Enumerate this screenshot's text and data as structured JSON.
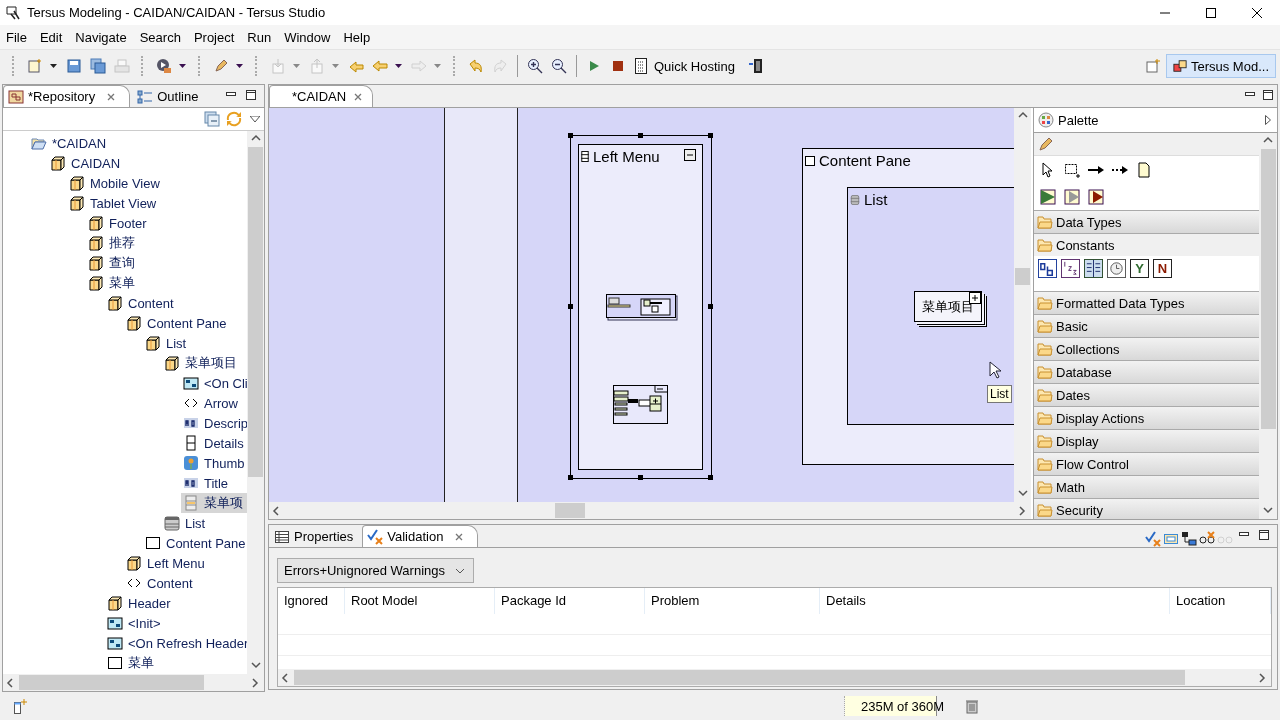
{
  "window": {
    "title": "Tersus Modeling - CAIDAN/CAIDAN - Tersus Studio"
  },
  "menu": [
    "File",
    "Edit",
    "Navigate",
    "Search",
    "Project",
    "Run",
    "Window",
    "Help"
  ],
  "toolbar": {
    "quick_hosting": "Quick Hosting",
    "perspective": {
      "label": "Tersus Mod...",
      "selected": true
    }
  },
  "left_panel": {
    "tabs": [
      {
        "label": "*Repository",
        "selected": true
      },
      {
        "label": "Outline",
        "selected": false
      }
    ],
    "tree": [
      {
        "label": "*CAIDAN",
        "kind": "folder",
        "selected": false,
        "children": [
          {
            "label": "CAIDAN",
            "kind": "model",
            "selected": false,
            "children": [
              {
                "label": "Mobile View",
                "kind": "model",
                "selected": false
              },
              {
                "label": "Tablet View",
                "kind": "model",
                "selected": false,
                "children": [
                  {
                    "label": "Footer",
                    "kind": "model",
                    "selected": false
                  },
                  {
                    "label": "推荐",
                    "kind": "model",
                    "selected": false
                  },
                  {
                    "label": "查询",
                    "kind": "model",
                    "selected": false
                  },
                  {
                    "label": "菜单",
                    "kind": "model",
                    "selected": false,
                    "children": [
                      {
                        "label": "Content",
                        "kind": "model",
                        "selected": false,
                        "children": [
                          {
                            "label": "Content Pane",
                            "kind": "model",
                            "selected": false,
                            "children": [
                              {
                                "label": "List",
                                "kind": "model",
                                "selected": false,
                                "children": [
                                  {
                                    "label": "菜单项目",
                                    "kind": "model",
                                    "selected": false,
                                    "children": [
                                      {
                                        "label": "<On Cli",
                                        "kind": "action",
                                        "selected": false
                                      },
                                      {
                                        "label": "Arrow",
                                        "kind": "tag",
                                        "selected": false
                                      },
                                      {
                                        "label": "Descrip",
                                        "kind": "text",
                                        "selected": false
                                      },
                                      {
                                        "label": "Details",
                                        "kind": "grid",
                                        "selected": false
                                      },
                                      {
                                        "label": "Thumb",
                                        "kind": "image",
                                        "selected": false
                                      },
                                      {
                                        "label": "Title",
                                        "kind": "text",
                                        "selected": false
                                      },
                                      {
                                        "label": "菜单项",
                                        "kind": "row",
                                        "selected": true
                                      }
                                    ]
                                  },
                                  {
                                    "label": "List",
                                    "kind": "list",
                                    "selected": false
                                  }
                                ]
                              },
                              {
                                "label": "Content Pane",
                                "kind": "pane",
                                "selected": false
                              }
                            ]
                          },
                          {
                            "label": "Left Menu",
                            "kind": "model",
                            "selected": false
                          },
                          {
                            "label": "Content",
                            "kind": "tag",
                            "selected": false
                          }
                        ]
                      },
                      {
                        "label": "Header",
                        "kind": "model",
                        "selected": false
                      },
                      {
                        "label": "<Init>",
                        "kind": "action",
                        "selected": false
                      },
                      {
                        "label": "<On Refresh Header",
                        "kind": "action",
                        "selected": false
                      },
                      {
                        "label": "菜单",
                        "kind": "pane",
                        "selected": false
                      }
                    ]
                  }
                ]
              }
            ]
          }
        ]
      }
    ]
  },
  "editor": {
    "tabs": [
      {
        "label": "*CAIDAN",
        "selected": true
      }
    ],
    "canvas": {
      "left_menu": {
        "title": "Left Menu",
        "selected": true
      },
      "content_pane": {
        "title": "Content Pane",
        "list": {
          "title": "List",
          "item": "菜单项目"
        }
      },
      "tooltip": "List"
    },
    "palette": {
      "title": "Palette",
      "drawers": [
        {
          "label": "Data Types",
          "expanded": false
        },
        {
          "label": "Constants",
          "expanded": true,
          "items": [
            {
              "kind": "text"
            },
            {
              "kind": "number"
            },
            {
              "kind": "table"
            },
            {
              "kind": "clock"
            },
            {
              "kind": "letter",
              "glyph": "Y",
              "color": "#2e6b2e"
            },
            {
              "kind": "letter",
              "glyph": "N",
              "color": "#8b1a00"
            }
          ]
        },
        {
          "label": "Formatted Data Types",
          "expanded": false
        },
        {
          "label": "Basic",
          "expanded": false
        },
        {
          "label": "Collections",
          "expanded": false
        },
        {
          "label": "Database",
          "expanded": false
        },
        {
          "label": "Dates",
          "expanded": false
        },
        {
          "label": "Display Actions",
          "expanded": false
        },
        {
          "label": "Display",
          "expanded": false
        },
        {
          "label": "Flow Control",
          "expanded": false
        },
        {
          "label": "Math",
          "expanded": false
        },
        {
          "label": "Security",
          "expanded": false
        }
      ]
    }
  },
  "bottom_panel": {
    "tabs": [
      {
        "label": "Properties",
        "kind": "properties",
        "selected": false
      },
      {
        "label": "Validation",
        "kind": "validation",
        "selected": true
      }
    ],
    "filter": "Errors+Unignored Warnings",
    "table": {
      "columns": [
        "Ignored",
        "Root Model",
        "Package Id",
        "Problem",
        "Details",
        "Location"
      ]
    }
  },
  "status_bar": {
    "memory": {
      "text": "235M of 360M",
      "level": 0.79
    }
  }
}
